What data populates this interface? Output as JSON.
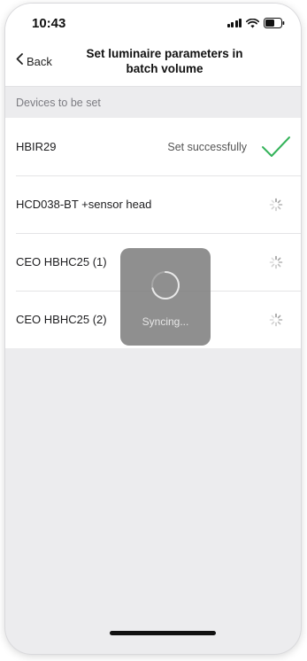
{
  "status_bar": {
    "time": "10:43",
    "icons": [
      "signal-icon",
      "wifi-icon",
      "battery-icon"
    ]
  },
  "nav": {
    "back_label": "Back",
    "title": "Set luminaire parameters in batch volume"
  },
  "section": {
    "header": "Devices to be set"
  },
  "devices": [
    {
      "name": "HBIR29",
      "status": "Set successfully",
      "state": "success",
      "icon": "checkmark-icon"
    },
    {
      "name": "HCD038-BT +sensor head",
      "status": "",
      "state": "pending",
      "icon": "spinner-icon"
    },
    {
      "name": "CEO HBHC25 (1)",
      "status": "",
      "state": "pending",
      "icon": "spinner-icon"
    },
    {
      "name": "CEO HBHC25 (2)",
      "status": "",
      "state": "pending",
      "icon": "spinner-icon"
    }
  ],
  "overlay": {
    "label": "Syncing...",
    "icon": "loading-ring-icon"
  },
  "colors": {
    "success_green": "#34b35a",
    "background": "#ececee",
    "hud": "#808080"
  }
}
